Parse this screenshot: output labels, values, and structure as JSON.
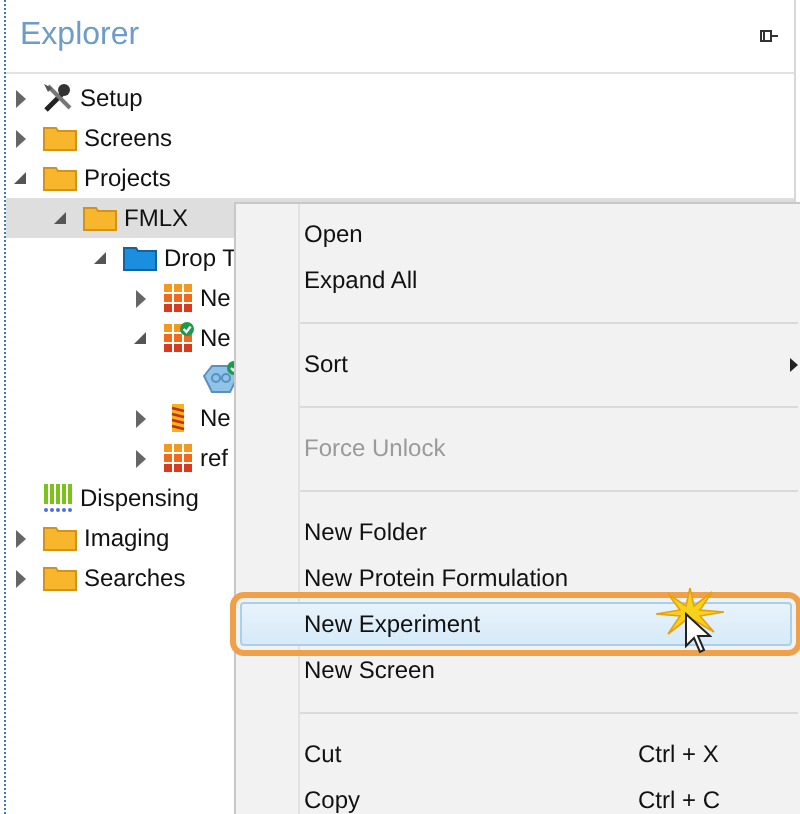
{
  "panel": {
    "title": "Explorer"
  },
  "tree": [
    {
      "label": "Setup",
      "kind": "tools",
      "expanded": false,
      "selected": false
    },
    {
      "label": "Screens",
      "kind": "folder",
      "expanded": false,
      "selected": false
    },
    {
      "label": "Projects",
      "kind": "folder",
      "expanded": true,
      "selected": false,
      "children": [
        {
          "label": "FMLX",
          "kind": "folder",
          "expanded": true,
          "selected": true,
          "children": [
            {
              "label": "Drop T",
              "kind": "container",
              "expanded": true,
              "selected": false,
              "children": [
                {
                  "label": "Ne",
                  "kind": "grid",
                  "expanded": false,
                  "selected": false
                },
                {
                  "label": "Ne",
                  "kind": "checked",
                  "expanded": true,
                  "selected": false,
                  "children": [
                    {
                      "kind": "plate",
                      "selected": false
                    }
                  ]
                },
                {
                  "label": "Ne",
                  "kind": "strip",
                  "expanded": false,
                  "selected": false
                },
                {
                  "label": "ref",
                  "kind": "grid",
                  "expanded": false,
                  "selected": false
                }
              ]
            }
          ]
        }
      ]
    },
    {
      "label": "Dispensing",
      "kind": "bars",
      "selected": false
    },
    {
      "label": "Imaging",
      "kind": "folder",
      "expanded": false,
      "selected": false
    },
    {
      "label": "Searches",
      "kind": "folder",
      "expanded": false,
      "selected": false
    }
  ],
  "menu": [
    {
      "kind": "item",
      "label": "Open",
      "disabled": false,
      "selected": false
    },
    {
      "kind": "item",
      "label": "Expand All",
      "disabled": false,
      "selected": false
    },
    {
      "kind": "separator"
    },
    {
      "kind": "item",
      "label": "Sort",
      "disabled": false,
      "selected": false,
      "submenu": true
    },
    {
      "kind": "separator"
    },
    {
      "kind": "item",
      "label": "Force Unlock",
      "disabled": true,
      "selected": false
    },
    {
      "kind": "separator"
    },
    {
      "kind": "item",
      "label": "New Folder",
      "disabled": false,
      "selected": false
    },
    {
      "kind": "item",
      "label": "New Protein Formulation",
      "disabled": false,
      "selected": false
    },
    {
      "kind": "item",
      "label": "New Experiment",
      "disabled": false,
      "selected": true
    },
    {
      "kind": "item",
      "label": "New Screen",
      "disabled": false,
      "selected": false
    },
    {
      "kind": "separator"
    },
    {
      "kind": "item",
      "label": "Cut",
      "disabled": false,
      "selected": false,
      "shortcut": "Ctrl + X"
    },
    {
      "kind": "item",
      "label": "Copy",
      "disabled": false,
      "selected": false,
      "shortcut": "Ctrl + C"
    }
  ]
}
